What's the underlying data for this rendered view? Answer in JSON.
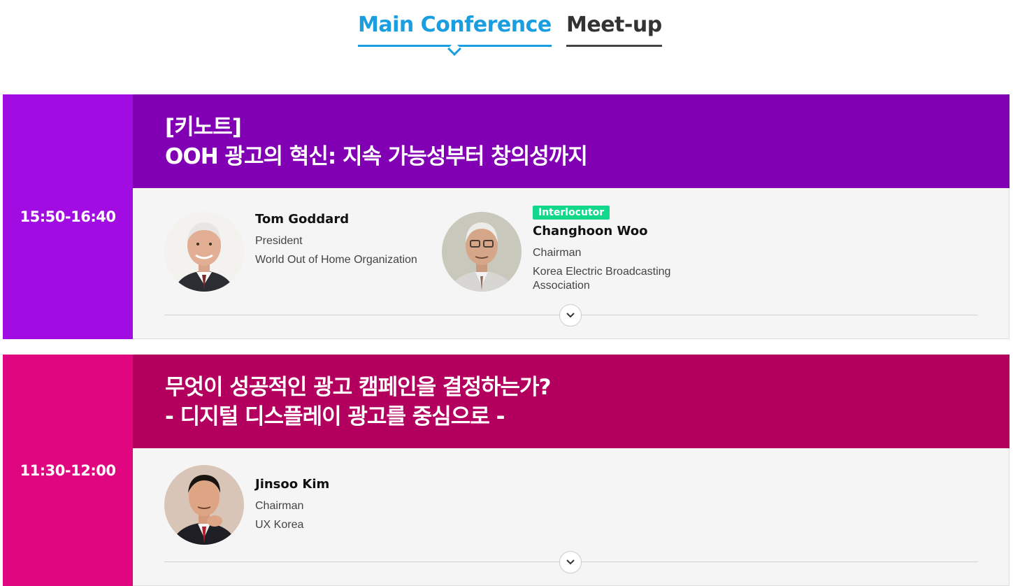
{
  "tabs": [
    {
      "label": "Main Conference",
      "active": true
    },
    {
      "label": "Meet-up",
      "active": false
    }
  ],
  "colors": {
    "accent": "#1a9ee0",
    "session1_time_bg": "#a10ce3",
    "session1_header_bg": "#8200b3",
    "session2_time_bg": "#e0067f",
    "session2_header_bg": "#b3005e",
    "badge": "#12d88c"
  },
  "sessions": [
    {
      "time": "15:50-16:40",
      "title_lines": [
        "[키노트]",
        "OOH 광고의 혁신: 지속 가능성부터 창의성까지"
      ],
      "speakers": [
        {
          "badge": "",
          "name": "Tom Goddard",
          "role": "President",
          "org": "World Out of Home Organization",
          "avatar_icon": "speaker-photo"
        },
        {
          "badge": "Interlocutor",
          "name": "Changhoon Woo",
          "role": "Chairman",
          "org": "Korea Electric Broadcasting Association",
          "avatar_icon": "speaker-photo"
        }
      ],
      "expand_icon": "chevron-down-icon"
    },
    {
      "time": "11:30-12:00",
      "title_lines": [
        "무엇이 성공적인 광고 캠페인을 결정하는가?",
        "- 디지털 디스플레이 광고를 중심으로 -"
      ],
      "speakers": [
        {
          "badge": "",
          "name": "Jinsoo Kim",
          "role": "Chairman",
          "org": "UX Korea",
          "avatar_icon": "speaker-photo"
        }
      ],
      "expand_icon": "chevron-down-icon"
    }
  ]
}
